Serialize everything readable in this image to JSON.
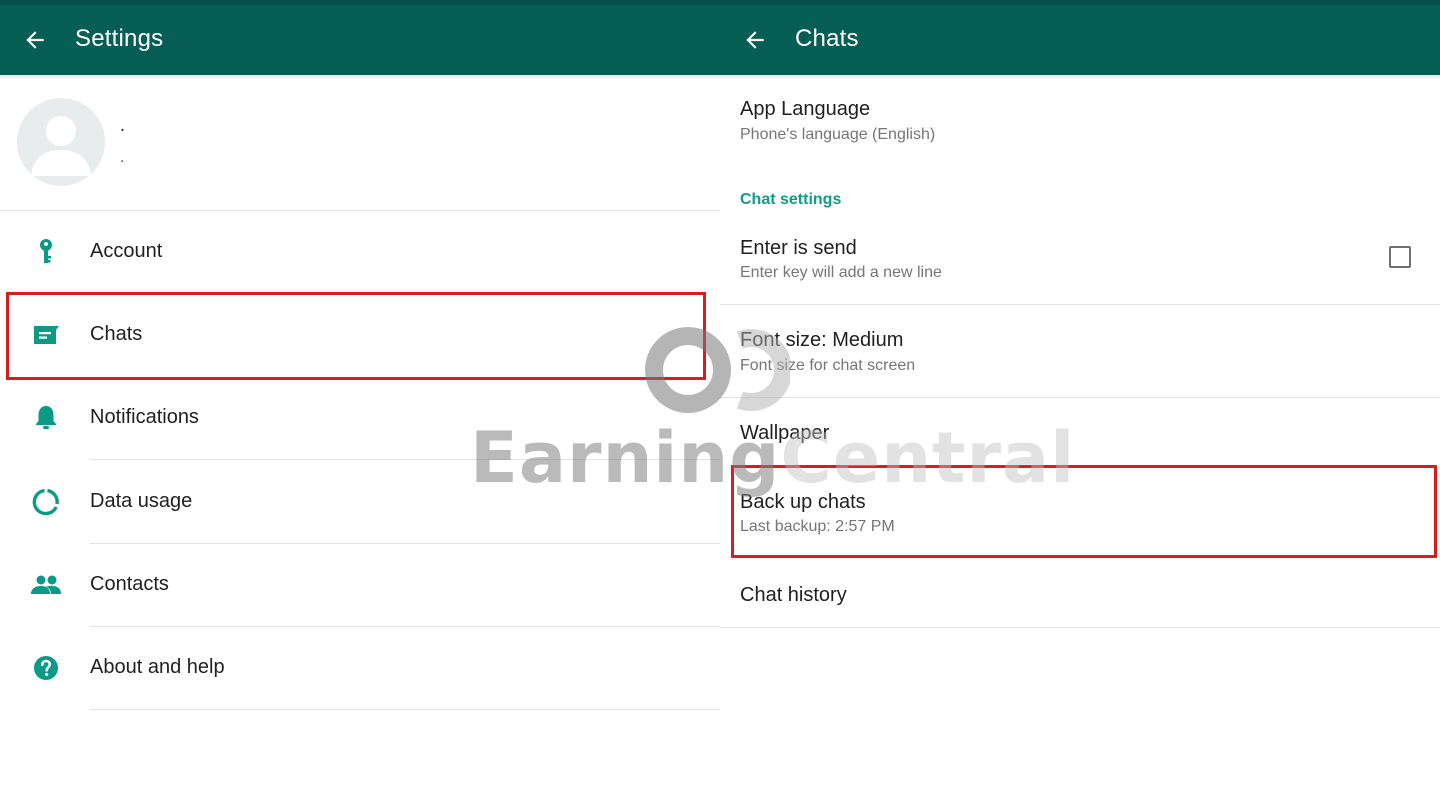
{
  "left": {
    "appbar": {
      "title": "Settings"
    },
    "profile": {
      "name": ".",
      "status": "."
    },
    "items": [
      {
        "label": "Account",
        "icon": "key-icon"
      },
      {
        "label": "Chats",
        "icon": "chat-icon"
      },
      {
        "label": "Notifications",
        "icon": "bell-icon"
      },
      {
        "label": "Data usage",
        "icon": "data-usage-icon"
      },
      {
        "label": "Contacts",
        "icon": "contacts-icon"
      },
      {
        "label": "About and help",
        "icon": "help-icon"
      }
    ]
  },
  "right": {
    "appbar": {
      "title": "Chats"
    },
    "app_language": {
      "title": "App Language",
      "subtitle": "Phone's language (English)"
    },
    "section_chat_settings": "Chat settings",
    "enter_is_send": {
      "title": "Enter is send",
      "subtitle": "Enter key will add a new line",
      "checked": false
    },
    "font_size": {
      "title": "Font size: Medium",
      "subtitle": "Font size for chat screen"
    },
    "wallpaper": {
      "title": "Wallpaper"
    },
    "backup": {
      "title": "Back up chats",
      "subtitle": "Last backup: 2:57 PM"
    },
    "chat_history": {
      "title": "Chat history"
    }
  },
  "watermark": {
    "word1": "Earning",
    "word2": "Central"
  },
  "colors": {
    "appbar": "#075e54",
    "accent": "#0f9d8a",
    "highlight": "#d71e1e"
  }
}
